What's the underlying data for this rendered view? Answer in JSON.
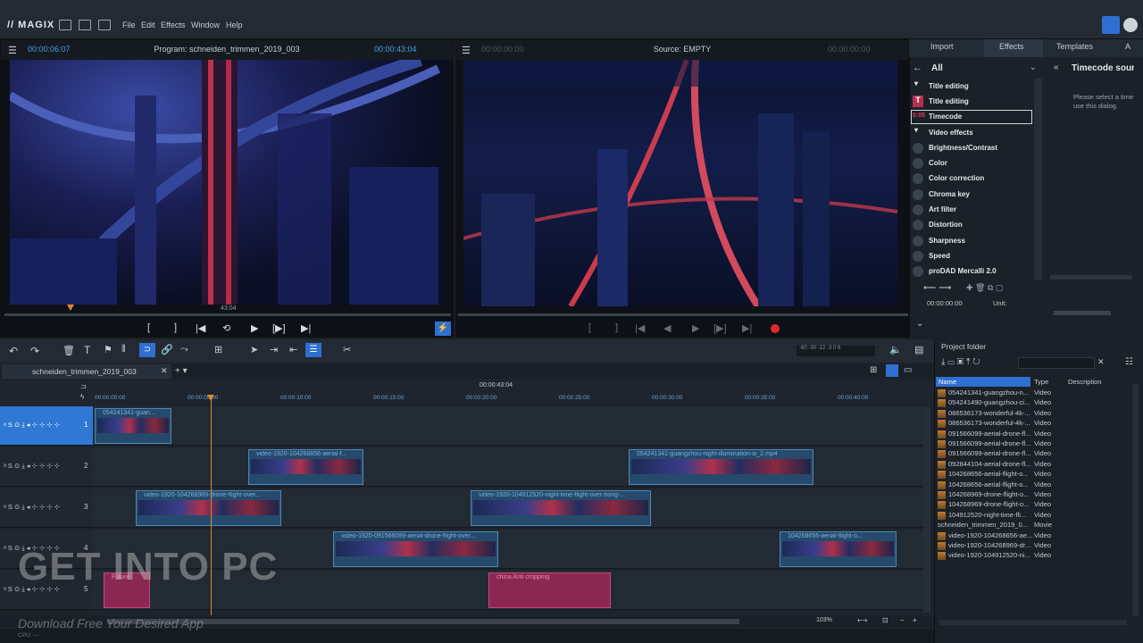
{
  "app": {
    "logo": "// MAGIX"
  },
  "menu": [
    "File",
    "Edit",
    "Effects",
    "Window",
    "Help"
  ],
  "program_monitor": {
    "tc_in": "00:00:06:07",
    "title": "Program: schneiden_trimmen_2019_003",
    "tc_out": "00:00:43:04",
    "scrub_label": "43:04"
  },
  "source_monitor": {
    "tc_in": "00:00:00:00",
    "title": "Source: EMPTY",
    "tc_out": "00:00:00:00"
  },
  "program_controls": [
    "[",
    "]",
    "|◀",
    "⟲",
    "▶",
    "[▶]",
    "▶|"
  ],
  "source_controls": [
    "[",
    "]",
    "|◀",
    "◀",
    "▶",
    "[▶]",
    "▶|"
  ],
  "right_panel": {
    "tabs": [
      "Import",
      "Effects",
      "Templates",
      "A"
    ],
    "breadcrumb": "All",
    "groups": [
      {
        "label": "Title editing"
      },
      {
        "label": "Video effects"
      }
    ],
    "title_items": [
      "Title editing",
      "Timecode"
    ],
    "effect_items": [
      "Brightness/Contrast",
      "Color",
      "Color correction",
      "Chroma key",
      "Art filter",
      "Distortion",
      "Sharpness",
      "Speed",
      "proDAD Mercalli 2.0"
    ],
    "selected_item": "Timecode",
    "detail_title": "Timecode sourc",
    "detail_text": "Please select a time use this dialog.",
    "tc_value": "00:00:00:00",
    "unit_label": "Unit:"
  },
  "timeline": {
    "tab": "schneiden_trimmen_2019_003",
    "center_tc": "00:00:43:04",
    "ruler": [
      "00:00:00:00",
      "00:00:05:00",
      "00:00:10:00",
      "00:00:15:00",
      "00:00:20:00",
      "00:00:25:00",
      "00:00:30:00",
      "00:00:35:00",
      "00:00:40:00"
    ],
    "track_numbers": [
      "1",
      "2",
      "3",
      "4",
      "5"
    ],
    "zoom": "103%",
    "cpu_label": "CPU: —",
    "clips": [
      {
        "track": 0,
        "label": "054241341-guan..."
      },
      {
        "track": 1,
        "label": "video-1920-104268656-aerial-f..."
      },
      {
        "track": 1,
        "label": "054241341-guangzhou-night-illumination-w_2.mp4"
      },
      {
        "track": 2,
        "label": "video-1920-104268969-drone-flight-over..."
      },
      {
        "track": 2,
        "label": "video-1920-104912520-night-time-flight-over-hong-..."
      },
      {
        "track": 3,
        "label": "video-1920-091566099-aerial-drone-flight-over..."
      },
      {
        "track": 3,
        "label": "104268656-aerial-flight-o..."
      },
      {
        "track": 4,
        "label": "Future"
      },
      {
        "track": 4,
        "label": "china   Anti cropping"
      }
    ]
  },
  "project": {
    "title": "Project folder",
    "columns": [
      "Name",
      "Type",
      "Description"
    ],
    "rows": [
      {
        "name": "054241341-guangzhou-n...",
        "type": "Video"
      },
      {
        "name": "054241490-guangzhou-ci...",
        "type": "Video"
      },
      {
        "name": "086536173-wonderful-4k-...",
        "type": "Video"
      },
      {
        "name": "086536173-wonderful-4k-...",
        "type": "Video"
      },
      {
        "name": "091566099-aerial-drone-fl...",
        "type": "Video"
      },
      {
        "name": "091566099-aerial-drone-fl...",
        "type": "Video"
      },
      {
        "name": "091566099-aerial-drone-fl...",
        "type": "Video"
      },
      {
        "name": "092844104-aerial-drone-fl...",
        "type": "Video"
      },
      {
        "name": "104268656-aerial-flight-o...",
        "type": "Video"
      },
      {
        "name": "104268656-aerial-flight-o...",
        "type": "Video"
      },
      {
        "name": "104268969-drone-flight-o...",
        "type": "Video"
      },
      {
        "name": "104268969-drone-flight-o...",
        "type": "Video"
      },
      {
        "name": "104912520-night-time-fli...",
        "type": "Video"
      },
      {
        "name": "schneiden_trimmen_2019_0...",
        "type": "Movie"
      },
      {
        "name": "video-1920-104268656-ae...",
        "type": "Video"
      },
      {
        "name": "video-1920-104268969-dr...",
        "type": "Video"
      },
      {
        "name": "video-1920-104912520-ni...",
        "type": "Video"
      }
    ]
  },
  "watermark": {
    "main": "GET INTO PC",
    "sub": "Download Free Your Desired App"
  }
}
